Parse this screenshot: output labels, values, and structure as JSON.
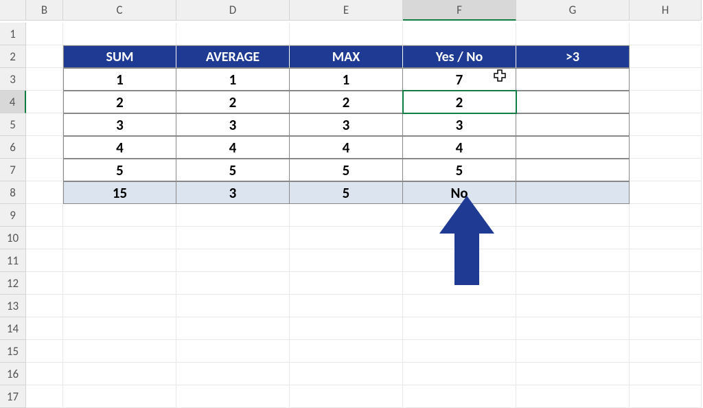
{
  "columns": [
    "B",
    "C",
    "D",
    "E",
    "F",
    "G",
    "H"
  ],
  "rows": [
    "1",
    "2",
    "3",
    "4",
    "5",
    "6",
    "7",
    "8",
    "9",
    "10",
    "11",
    "12",
    "13",
    "14",
    "15",
    "16",
    "17"
  ],
  "active_column_index": 4,
  "active_row_index": 3,
  "table": {
    "headers": [
      "SUM",
      "AVERAGE",
      "MAX",
      "Yes / No",
      ">3"
    ],
    "rows": [
      [
        "1",
        "1",
        "1",
        "7",
        ""
      ],
      [
        "2",
        "2",
        "2",
        "2",
        ""
      ],
      [
        "3",
        "3",
        "3",
        "3",
        ""
      ],
      [
        "4",
        "4",
        "4",
        "4",
        ""
      ],
      [
        "5",
        "5",
        "5",
        "5",
        ""
      ]
    ],
    "summary": [
      "15",
      "3",
      "5",
      "No",
      ""
    ]
  },
  "colors": {
    "header_bg": "#1f3a93",
    "summary_bg": "#dce4f0",
    "arrow": "#1f3a93",
    "selection": "#107c41"
  },
  "cursor": {
    "visible": true
  }
}
